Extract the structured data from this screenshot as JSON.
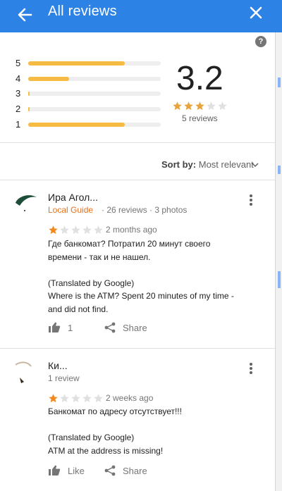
{
  "header": {
    "title": "All reviews"
  },
  "summary": {
    "average": "3.2",
    "rating_value": 3,
    "count_text": "5 reviews",
    "histogram": [
      {
        "label": "5",
        "fraction": 0.73
      },
      {
        "label": "4",
        "fraction": 0.31
      },
      {
        "label": "3",
        "fraction": 0.01
      },
      {
        "label": "2",
        "fraction": 0.01
      },
      {
        "label": "1",
        "fraction": 0.73
      }
    ]
  },
  "sort": {
    "label": "Sort by:",
    "value": "Most relevant"
  },
  "reviews": [
    {
      "author": "Ира Агол...",
      "badge": "Local Guide",
      "meta": "· 26 reviews · 3 photos",
      "rating": 1,
      "date": "2 months ago",
      "text": [
        "Где банкомат? Потратил 20 минут своего",
        "времени - так и не нашел.",
        "",
        "(Translated by Google)",
        "Where is the ATM? Spent 20 minutes of my time -",
        "and did not find."
      ],
      "like_label": "1",
      "share_label": "Share"
    },
    {
      "author": "Ки...",
      "meta": "1 review",
      "rating": 1,
      "date": "2 weeks ago",
      "text": [
        "Банкомат по адресу отсутствует!!!",
        "",
        "(Translated by Google)",
        "ATM at the address is missing!"
      ],
      "like_label": "Like",
      "share_label": "Share"
    }
  ],
  "colors": {
    "header": "#2d82e6",
    "star": "#f6bb42",
    "star_empty": "#e0e0e0",
    "badge": "#e5721e"
  }
}
